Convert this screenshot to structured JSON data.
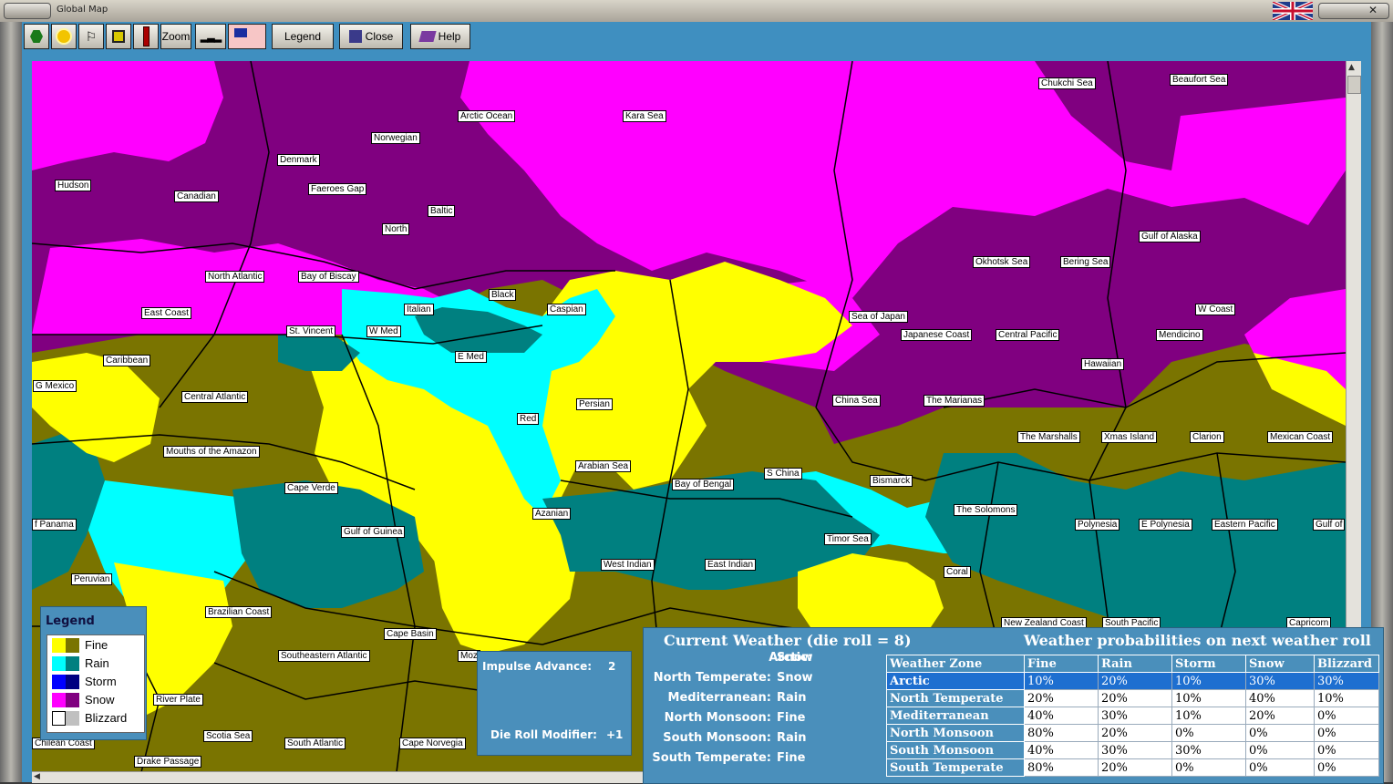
{
  "window": {
    "title": "Global Map"
  },
  "toolbar": {
    "zoom_label": "Zoom",
    "legend_label": "Legend",
    "close_label": "Close",
    "help_label": "Help"
  },
  "colors": {
    "fine_light": "#ffff00",
    "fine_dark": "#7a7400",
    "rain_light": "#00ffff",
    "rain_dark": "#008080",
    "storm_light": "#0000ff",
    "storm_dark": "#000080",
    "snow_light": "#ff00ff",
    "snow_dark": "#800080",
    "blizzard_light": "#ffffff",
    "blizzard_dark": "#c0c0c0"
  },
  "map_labels": [
    "Chukchi Sea",
    "Beaufort Sea",
    "Arctic Ocean",
    "Kara Sea",
    "Norwegian",
    "Denmark",
    "Hudson",
    "Canadian",
    "Faeroes Gap",
    "Baltic",
    "North",
    "Gulf of Alaska",
    "Okhotsk Sea",
    "Bering Sea",
    "North Atlantic",
    "Bay of Biscay",
    "W Coast",
    "East Coast",
    "Black",
    "Caspian",
    "Italian",
    "Sea of Japan",
    "St. Vincent",
    "W Med",
    "E Med",
    "Japanese Coast",
    "Central Pacific",
    "Mendicino",
    "Caribbean",
    "Hawaiian",
    "G Mexico",
    "Central Atlantic",
    "China Sea",
    "The Marianas",
    "Persian",
    "Red",
    "The Marshalls",
    "Xmas Island",
    "Clarion",
    "Mexican Coast",
    "Mouths of the Amazon",
    "Arabian Sea",
    "S China",
    "Bismarck",
    "Cape Verde",
    "Bay of Bengal",
    "The Solomons",
    "Azanian",
    "Gulf of Guinea",
    "Polynesia",
    "E Polynesia",
    "Eastern Pacific",
    "Gulf of",
    "f Panama",
    "Timor Sea",
    "West Indian",
    "East Indian",
    "Coral",
    "Peruvian",
    "Brazilian Coast",
    "New Zealand Coast",
    "South Pacific",
    "Capricorn",
    "Cape Basin",
    "Southeastern Atlantic",
    "Moz",
    "River Plate",
    "Scotia Sea",
    "Chilean Coast",
    "South Atlantic",
    "Cape Norvegia",
    "Drake Passage"
  ],
  "legend": {
    "title": "Legend",
    "items": [
      {
        "label": "Fine",
        "light": "#ffff00",
        "dark": "#7a7400"
      },
      {
        "label": "Rain",
        "light": "#00ffff",
        "dark": "#008080"
      },
      {
        "label": "Storm",
        "light": "#0000ff",
        "dark": "#000080"
      },
      {
        "label": "Snow",
        "light": "#ff00ff",
        "dark": "#800080"
      },
      {
        "label": "Blizzard",
        "light": "#ffffff",
        "dark": "#c0c0c0"
      }
    ]
  },
  "impulse": {
    "advance_label": "Impulse Advance:",
    "advance_value": "2",
    "modifier_label": "Die Roll Modifier:",
    "modifier_value": "+1"
  },
  "current_weather": {
    "title": "Current Weather (die roll = 8)",
    "zones": [
      {
        "zone": "Arctic:",
        "weather": "Snow"
      },
      {
        "zone": "North Temperate:",
        "weather": "Snow"
      },
      {
        "zone": "Mediterranean:",
        "weather": "Rain"
      },
      {
        "zone": "North Monsoon:",
        "weather": "Fine"
      },
      {
        "zone": "South Monsoon:",
        "weather": "Rain"
      },
      {
        "zone": "South Temperate:",
        "weather": "Fine"
      }
    ]
  },
  "probabilities": {
    "title": "Weather probabilities on next weather roll",
    "headers": [
      "Weather Zone",
      "Fine",
      "Rain",
      "Storm",
      "Snow",
      "Blizzard"
    ],
    "rows": [
      [
        "Arctic",
        "10%",
        "20%",
        "10%",
        "30%",
        "30%"
      ],
      [
        "North Temperate",
        "20%",
        "20%",
        "10%",
        "40%",
        "10%"
      ],
      [
        "Mediterranean",
        "40%",
        "30%",
        "10%",
        "20%",
        "0%"
      ],
      [
        "North Monsoon",
        "80%",
        "20%",
        "0%",
        "0%",
        "0%"
      ],
      [
        "South Monsoon",
        "40%",
        "30%",
        "30%",
        "0%",
        "0%"
      ],
      [
        "South Temperate",
        "80%",
        "20%",
        "0%",
        "0%",
        "0%"
      ]
    ],
    "selected_row": "Arctic"
  }
}
